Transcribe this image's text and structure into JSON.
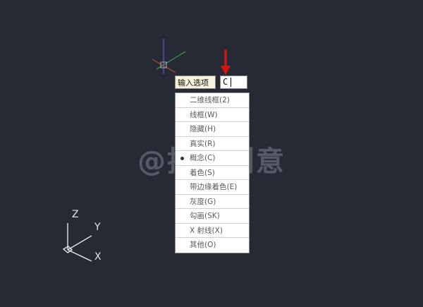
{
  "command_prompt": {
    "label": "输入选项",
    "input_value": "C"
  },
  "menu": {
    "items": [
      {
        "label": "二维线框(2)",
        "selected": false
      },
      {
        "label": "线框(W)",
        "selected": false
      },
      {
        "label": "隐藏(H)",
        "selected": false
      },
      {
        "label": "真实(R)",
        "selected": false
      },
      {
        "label": "概念(C)",
        "selected": true
      },
      {
        "label": "着色(S)",
        "selected": false
      },
      {
        "label": "带边缘着色(E)",
        "selected": false
      },
      {
        "label": "灰度(G)",
        "selected": false
      },
      {
        "label": "勾画(SK)",
        "selected": false
      },
      {
        "label": "X 射线(X)",
        "selected": false
      },
      {
        "label": "其他(O)",
        "selected": false
      }
    ]
  },
  "ucs_icon": {
    "x_label": "X",
    "y_label": "Y",
    "z_label": "Z"
  },
  "watermark": "@推统创意",
  "colors": {
    "background": "#252a35",
    "annotation_arrow": "#e01010",
    "crosshair_vertical": "#5a5ab4",
    "crosshair_horizontal": "#b04848",
    "crosshair_green": "#3fa04a"
  }
}
